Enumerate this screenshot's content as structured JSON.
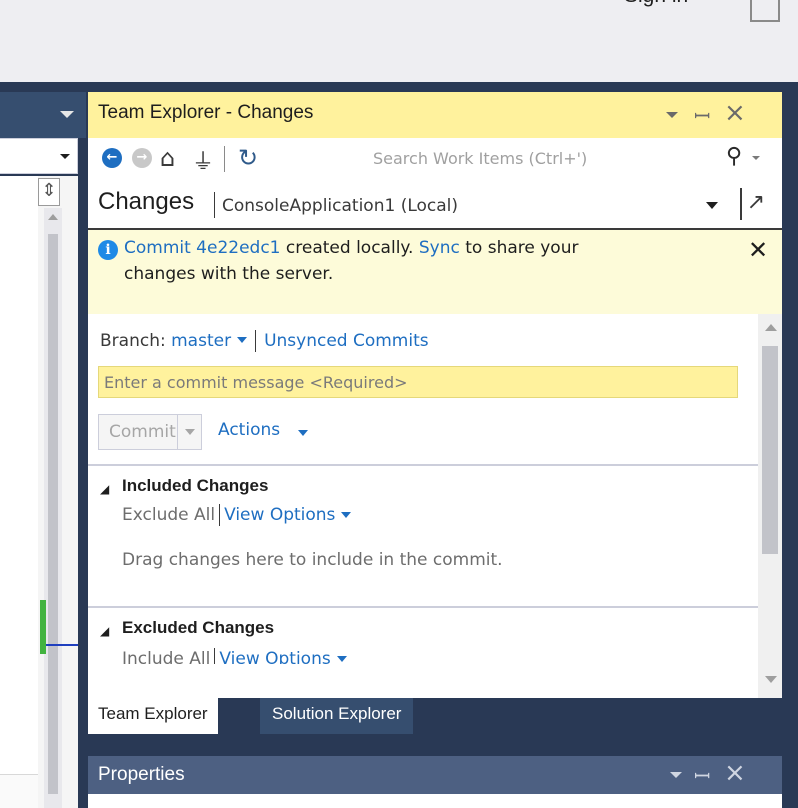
{
  "top_bar": {
    "sign_in": "Sign in"
  },
  "team_explorer": {
    "title": "Team Explorer - Changes",
    "search_placeholder": "Search Work Items (Ctrl+')",
    "header_title": "Changes",
    "header_context": "ConsoleApplication1 (Local)",
    "notification": {
      "commit_link": "Commit 4e22edc1",
      "text_after_commit": " created locally. ",
      "sync_link": "Sync",
      "text_after_sync": " to share your",
      "line2": "changes with the server."
    },
    "branch_label": "Branch: ",
    "branch_name": "master",
    "unsynced_commits": "Unsynced Commits",
    "commit_message_placeholder": "Enter a commit message <Required>",
    "commit_button": "Commit",
    "actions": "Actions",
    "included": {
      "header": "Included Changes",
      "exclude_all": "Exclude All",
      "view_options": "View Options",
      "drag_hint": "Drag changes here to include in the commit."
    },
    "excluded": {
      "header": "Excluded Changes",
      "include_all": "Include All",
      "view_options": "View Options"
    }
  },
  "tabs": {
    "team_explorer": "Team Explorer",
    "solution_explorer": "Solution Explorer"
  },
  "properties": {
    "title": "Properties"
  },
  "colors": {
    "frame": "#293955",
    "active_title": "#fff29d",
    "link": "#1e6ec1",
    "info": "#fdfbd9"
  },
  "icons": {
    "back": "back-arrow-icon",
    "forward": "forward-arrow-icon",
    "home": "home-icon",
    "connect": "plug-icon",
    "refresh": "refresh-icon",
    "search": "search-icon",
    "info": "info-icon",
    "close": "close-icon",
    "pin": "pin-icon",
    "popout": "popout-icon"
  }
}
